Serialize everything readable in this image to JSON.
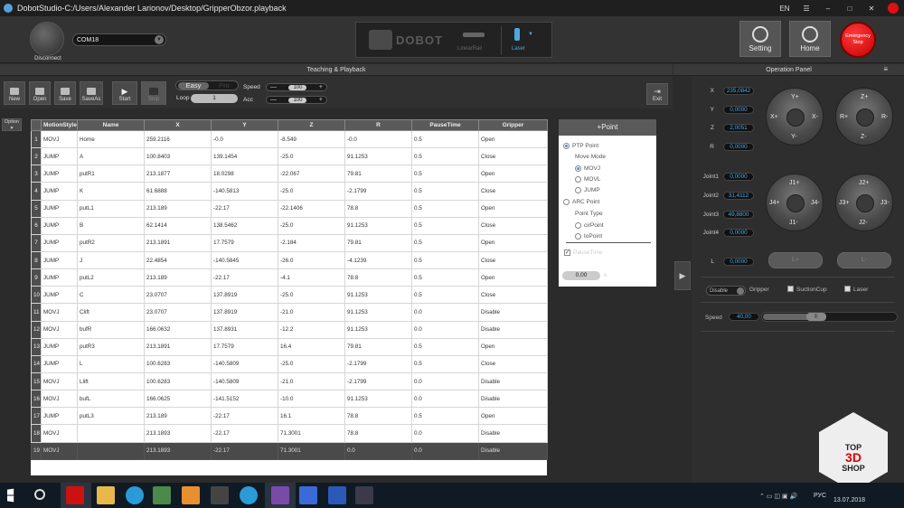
{
  "window": {
    "title": "DobotStudio-C:/Users/Alexander Larionov/Desktop/GripperObzor.playback",
    "lang": "EN",
    "menu_icon": "☰",
    "min_icon": "–",
    "max_icon": "□",
    "close_icon": "✕"
  },
  "topbar": {
    "disconnect_label": "Disconnect",
    "port": "COM18",
    "brand": "DOBOT",
    "linear_rail_label": "LinearRail",
    "laser_label": "Laser",
    "setting_label": "Setting",
    "home_label": "Home",
    "estop_label": "Emergency Stop"
  },
  "teaching": {
    "header": "Teaching & Playback",
    "buttons": {
      "new": "New",
      "open": "Open",
      "save": "Save",
      "saveas": "SaveAs",
      "start": "Start",
      "stop": "Stop",
      "exit": "Exit"
    },
    "mode_easy": "Easy",
    "mode_pro": "Pro",
    "loop_label": "Loop",
    "loop_value": "1",
    "speed_label": "Speed",
    "speed_value": "100",
    "acc_label": "Acc",
    "acc_value": "100",
    "minus": "—",
    "plus": "+",
    "option_label": "Option"
  },
  "table": {
    "columns": [
      "",
      "MotionStyle",
      "Name",
      "X",
      "Y",
      "Z",
      "R",
      "PauseTime",
      "Gripper"
    ],
    "rows": [
      [
        "1",
        "MOVJ",
        "Home",
        "259.2116",
        "-0.0",
        "-8.549",
        "-0.0",
        "0.5",
        "Open"
      ],
      [
        "2",
        "JUMP",
        "A",
        "100.8403",
        "139.1454",
        "-25.0",
        "91.1253",
        "0.5",
        "Close"
      ],
      [
        "3",
        "JUMP",
        "putR1",
        "213.1877",
        "18.0298",
        "-22.067",
        "79.81",
        "0.5",
        "Open"
      ],
      [
        "4",
        "JUMP",
        "K",
        "61.6888",
        "-140.5813",
        "-25.0",
        "-2.1799",
        "0.5",
        "Close"
      ],
      [
        "5",
        "JUMP",
        "putL1",
        "213.189",
        "-22.17",
        "-22.1406",
        "78.8",
        "0.5",
        "Open"
      ],
      [
        "6",
        "JUMP",
        "B",
        "62.1414",
        "138.5462",
        "-25.0",
        "91.1253",
        "0.5",
        "Close"
      ],
      [
        "7",
        "JUMP",
        "putR2",
        "213.1891",
        "17.7579",
        "-2.184",
        "79.81",
        "0.5",
        "Open"
      ],
      [
        "8",
        "JUMP",
        "J",
        "22.4854",
        "-140.5845",
        "-26.0",
        "-4.1239",
        "0.5",
        "Close"
      ],
      [
        "9",
        "JUMP",
        "putL2",
        "213.189",
        "-22.17",
        "-4.1",
        "78.8",
        "0.5",
        "Open"
      ],
      [
        "10",
        "JUMP",
        "C",
        "23.0707",
        "137.8919",
        "-25.0",
        "91.1253",
        "0.5",
        "Close"
      ],
      [
        "11",
        "MOVJ",
        "Clift",
        "23.0707",
        "137.8919",
        "-21.0",
        "91.1253",
        "0.0",
        "Disable"
      ],
      [
        "12",
        "MOVJ",
        "bufR",
        "166.0632",
        "137.8931",
        "-12.2",
        "91.1253",
        "0.0",
        "Disable"
      ],
      [
        "13",
        "JUMP",
        "putR3",
        "213.1891",
        "17.7579",
        "16.4",
        "79.81",
        "0.5",
        "Open"
      ],
      [
        "14",
        "JUMP",
        "L",
        "100.6283",
        "-140.5809",
        "-25.0",
        "-2.1799",
        "0.5",
        "Close"
      ],
      [
        "15",
        "MOVJ",
        "Llift",
        "100.6283",
        "-140.5809",
        "-21.0",
        "-2.1799",
        "0.0",
        "Disable"
      ],
      [
        "16",
        "MOVJ",
        "bufL",
        "166.0625",
        "-141.5152",
        "-10.0",
        "91.1253",
        "0.0",
        "Disable"
      ],
      [
        "17",
        "JUMP",
        "putL3",
        "213.189",
        "-22.17",
        "16.1",
        "78.8",
        "0.5",
        "Open"
      ],
      [
        "18",
        "MOVJ",
        "",
        "213.1893",
        "-22.17",
        "71.3001",
        "78.8",
        "0.0",
        "Disable"
      ],
      [
        "19",
        "MOVJ",
        "",
        "213.1893",
        "-22.17",
        "71.3001",
        "0.0",
        "0.0",
        "Disable"
      ]
    ]
  },
  "point_panel": {
    "add_point": "+Point",
    "ptp_label": "PTP Point",
    "move_mode_label": "Move Mode",
    "movj": "MOVJ",
    "movl": "MOVL",
    "jump": "JUMP",
    "arc_label": "ARC Point",
    "point_type_label": "Point Type",
    "cir_point": "cirPoint",
    "to_point": "toPoint",
    "pause_time_label": "PauseTime",
    "pause_value": "0,00",
    "pause_unit": "s",
    "check_mark": "✓"
  },
  "operation": {
    "header": "Operation Panel",
    "coords": [
      {
        "label": "X",
        "value": "235,0842"
      },
      {
        "label": "Y",
        "value": "0,0000"
      },
      {
        "label": "Z",
        "value": "2,0051"
      },
      {
        "label": "R",
        "value": "0,0000"
      }
    ],
    "joints": [
      {
        "label": "Joint1",
        "value": "0,0000"
      },
      {
        "label": "Joint2",
        "value": "31,4112"
      },
      {
        "label": "Joint3",
        "value": "49,8800"
      },
      {
        "label": "Joint4",
        "value": "0,0000"
      }
    ],
    "l_label": "L",
    "l_value": "0,0000",
    "l_plus": "L+",
    "l_minus": "L-",
    "joy_xy": {
      "top": "Y+",
      "bottom": "Y-",
      "left": "X+",
      "right": "X-"
    },
    "joy_zr": {
      "top": "Z+",
      "bottom": "Z-",
      "left": "R+",
      "right": "R-"
    },
    "joy_j1": {
      "top": "J1+",
      "bottom": "J1-",
      "left": "J4+",
      "right": "J4-"
    },
    "joy_j2": {
      "top": "J2+",
      "bottom": "J2-",
      "left": "J3+",
      "right": "J3-"
    },
    "end_tool_value": "Disable",
    "gripper_label": "Gripper",
    "suction_label": "SuctionCup",
    "laser_label": "Laser",
    "speed_label": "Speed",
    "speed_value": "40,00",
    "speed_fraction": 0.4,
    "speed_thumb_glyph": "|||"
  },
  "taskbar": {
    "lang": "РУС",
    "date": "13.07.2018"
  },
  "watermark": {
    "top": "TOP",
    "mid": "3D",
    "bottom": "SHOP"
  },
  "colors": {
    "accent": "#4aa8e0",
    "estop": "#e01010"
  }
}
